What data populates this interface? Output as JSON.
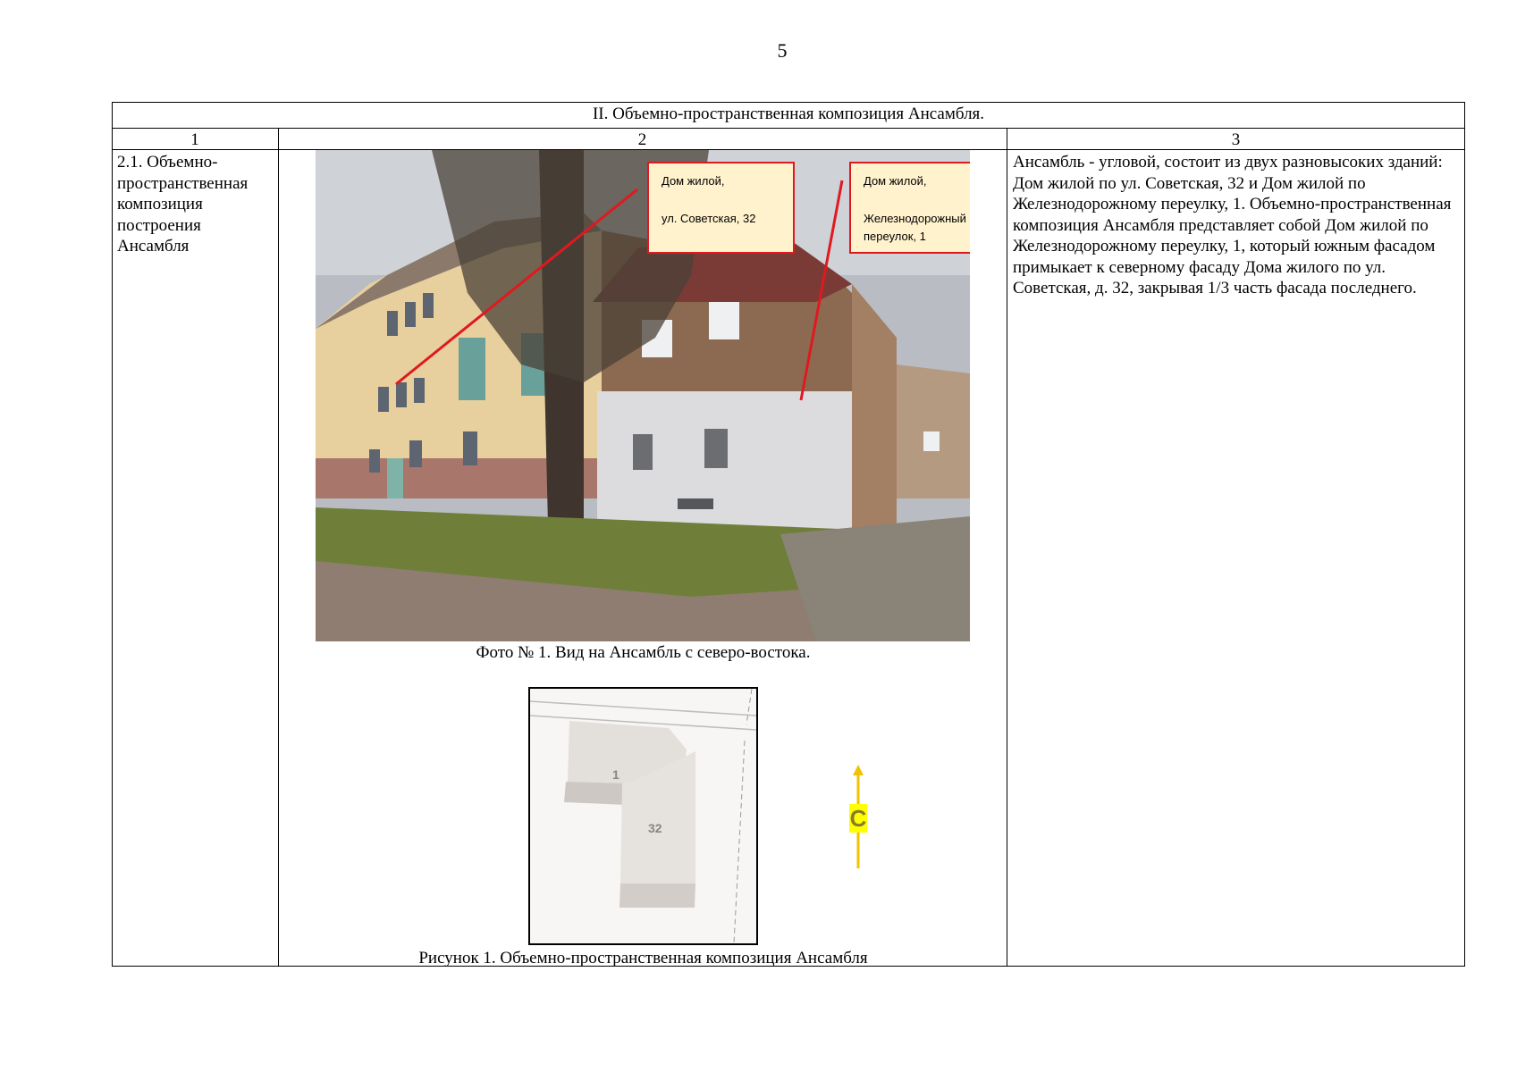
{
  "page": {
    "number": "5"
  },
  "section": {
    "title": "II.  Объемно-пространственная композиция Ансамбля."
  },
  "columns": [
    "1",
    "2",
    "3"
  ],
  "row": {
    "item": "2.1.  Объемно-пространственная композиция построения Ансамбля",
    "description": "Ансамбль - угловой, состоит из двух разновысоких зданий: Дом жилой по ул. Советская, 32 и Дом жилой по Железнодорожному переулку, 1. Объемно-пространственная композиция Ансамбля представляет собой Дом жилой по Железнодорожному переулку, 1, который южным фасадом примыкает к северному фасаду Дома жилого по ул. Советская, д. 32, закрывая 1/3 часть фасада последнего."
  },
  "photo": {
    "label_left": {
      "line1": "Дом жилой,",
      "line2": "ул. Советская, 32"
    },
    "label_right": {
      "line1": "Дом жилой,",
      "line2": "Железнодорожный",
      "line3": "переулок, 1"
    },
    "caption": "Фото № 1. Вид на Ансамбль с северо-востока."
  },
  "figure": {
    "building_a": "1",
    "building_b": "32",
    "north_letter": "С",
    "caption": "Рисунок 1.  Объемно-пространственная композиция Ансамбля"
  },
  "colors": {
    "callout_border": "#e0191f",
    "callout_fill": "#fff2cc",
    "north_arrow": "#f2c200",
    "north_highlight": "#ffff00"
  }
}
